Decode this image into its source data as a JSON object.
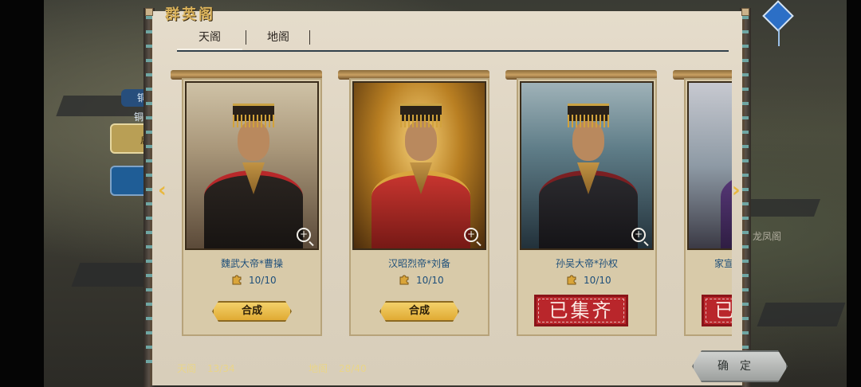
{
  "panel": {
    "title": "群英阁",
    "tabs": [
      {
        "label": "天阁",
        "active": true
      },
      {
        "label": "地阁",
        "active": false
      }
    ]
  },
  "cards": [
    {
      "name": "魏武大帝*曹操",
      "progress": "10/10",
      "action": "合成",
      "collected": false,
      "accent": "#b8282a"
    },
    {
      "name": "汉昭烈帝*刘备",
      "progress": "10/10",
      "action": "合成",
      "collected": false,
      "accent": "#c7352f"
    },
    {
      "name": "孙吴大帝*孙权",
      "progress": "10/10",
      "action": "已集齐",
      "collected": true,
      "accent": "#7b1f22"
    },
    {
      "name": "家宣",
      "progress": "",
      "action": "已",
      "collected": true,
      "accent": "#5a3a7c"
    }
  ],
  "footer": {
    "tian_label": "天阁",
    "tian_value": "13/34",
    "di_label": "地阁",
    "di_value": "28/40"
  },
  "confirm_label": "确定",
  "background": {
    "side_button_1": "铜",
    "side_button_2": "铜",
    "side_button_3": "启",
    "location_label": "龙凤阁"
  },
  "icons": {
    "zoom": "magnifier-plus-icon",
    "fragment": "puzzle-piece-icon",
    "nav_left": "chevron-left-icon",
    "nav_right": "chevron-right-icon",
    "kite": "kite-icon"
  },
  "colors": {
    "title_gold": "#d9b25b",
    "name_blue": "#1e4f7a",
    "merge_button": "#e6b23d",
    "stamp_red": "#b9262b"
  }
}
